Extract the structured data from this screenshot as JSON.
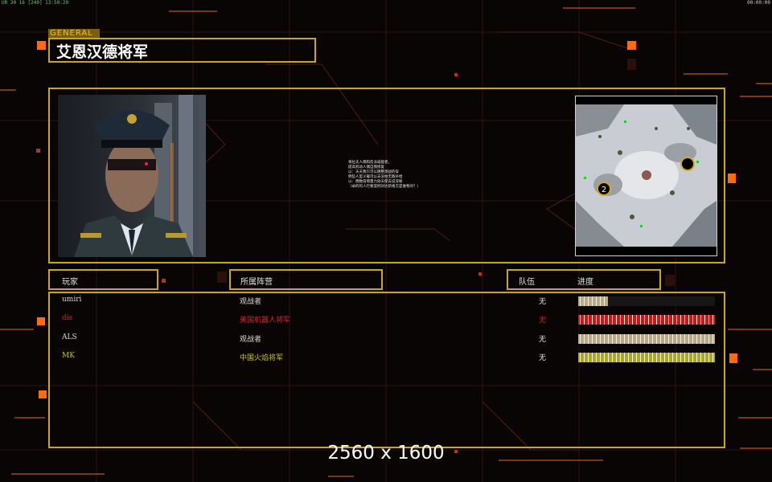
{
  "status": {
    "left_text": "UR 30 16 [240] 13:50:20",
    "right_text": "00:00:00"
  },
  "general": {
    "tag": "GENERAL",
    "name": "艾恩汉德将军"
  },
  "briefing": {
    "lines": [
      "将拉夫人偶和反派威能者，",
      "提高机动人偶自我修复",
      "以：天天我只可以跳整测战的穿",
      "佣些人型义载可以去没拍无敌补给",
      "以：偶数倍增量力效天使去说深秘",
      "（卓的的人行要案例对达新格方是谁物对？）"
    ]
  },
  "minimap": {
    "player_marker": "2"
  },
  "columns": {
    "player": "玩家",
    "faction": "所属阵营",
    "team": "队伍",
    "progress": "进度"
  },
  "players": [
    {
      "name": "umiri",
      "faction": "观战者",
      "team": "无",
      "progress": 0.22,
      "color": "#d8d8d8",
      "bar_color": "#b8aa88"
    },
    {
      "name": "dis",
      "faction": "美国机器人将军",
      "team": "无",
      "progress": 1.0,
      "color": "#e02020",
      "bar_color": "#c81818"
    },
    {
      "name": "ALS",
      "faction": "观战者",
      "team": "无",
      "progress": 1.0,
      "color": "#d8d8d8",
      "bar_color": "#b8aa88"
    },
    {
      "name": "MK",
      "faction": "中国火焰将军",
      "team": "无",
      "progress": 1.0,
      "color": "#c8c030",
      "bar_color": "#a8a830"
    }
  ],
  "resolution_label": "2560 x 1600",
  "colors": {
    "frame": "#c8a818",
    "accent_orange": "#ff7010",
    "background": "#0a0505"
  }
}
